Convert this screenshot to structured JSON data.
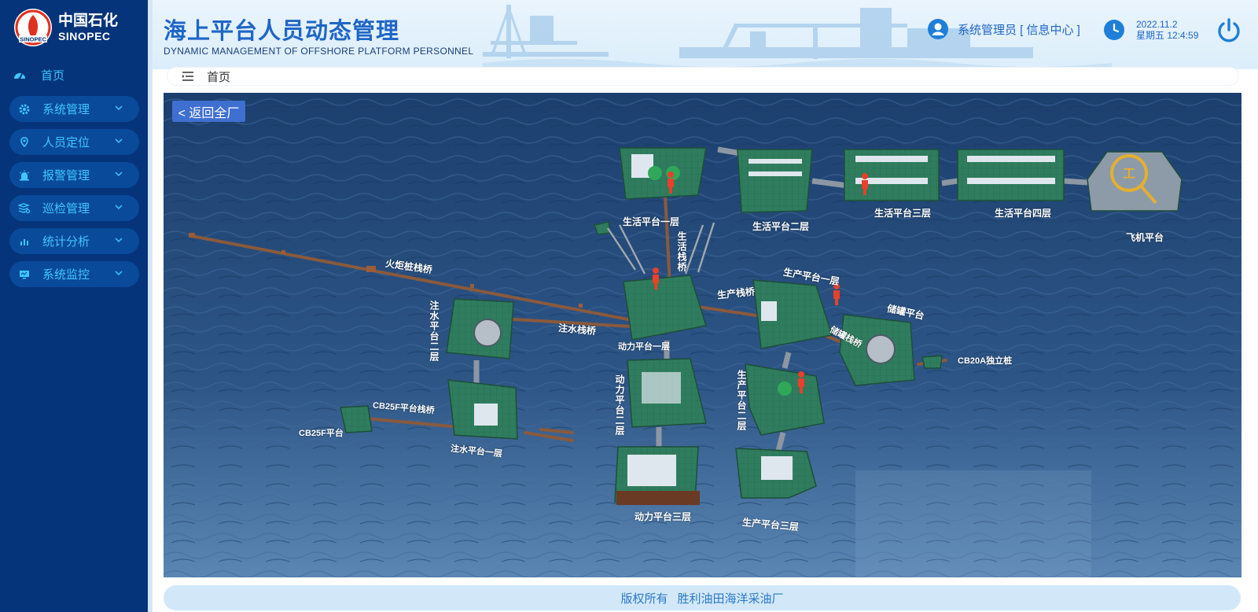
{
  "brand": {
    "logo_cn": "中国石化",
    "logo_en": "SINOPEC",
    "logo_mark_text": "SINOPEC"
  },
  "header": {
    "title": "海上平台人员动态管理",
    "subtitle": "DYNAMIC MANAGEMENT OF OFFSHORE PLATFORM PERSONNEL",
    "user": "系统管理员 [ 信息中心 ]",
    "date": "2022.11.2",
    "weekday_time": "星期五 12:4:59"
  },
  "sidebar": {
    "home": {
      "label": "首页",
      "icon": "dashboard-icon"
    },
    "items": [
      {
        "label": "系统管理",
        "icon": "gear-icon"
      },
      {
        "label": "人员定位",
        "icon": "location-pin-icon"
      },
      {
        "label": "报警管理",
        "icon": "alarm-icon"
      },
      {
        "label": "巡检管理",
        "icon": "inspection-icon"
      },
      {
        "label": "统计分析",
        "icon": "bar-chart-icon"
      },
      {
        "label": "系统监控",
        "icon": "monitor-icon"
      }
    ]
  },
  "breadcrumb": {
    "label": "首页"
  },
  "map": {
    "back_button": "< 返回全厂",
    "labels": {
      "living1": "生活平台一层",
      "living2": "生活平台二层",
      "living3": "生活平台三层",
      "living4": "生活平台四层",
      "heli": "飞机平台",
      "living_bridge": "生活栈桥",
      "flare_bridge": "火炬桩栈桥",
      "prod_bridge": "生产栈桥",
      "prod1": "生产平台一层",
      "storage": "储罐平台",
      "storage_bridge": "储罐栈桥",
      "cb20a": "CB20A独立桩",
      "inject2": "注水平台二层",
      "inject_bridge": "注水栈桥",
      "power1": "动力平台一层",
      "power2": "动力平台二层",
      "prod2": "生产平台二层",
      "cb25f_bridge": "CB25F平台栈桥",
      "cb25f": "CB25F平台",
      "inject1": "注水平台一层",
      "power3": "动力平台三层",
      "prod3": "生产平台三层"
    },
    "colors": {
      "sea": "#2a4f7e",
      "deck": "#2f7d5e",
      "person": "#e8402a",
      "bridge": "#8a5a3c"
    }
  },
  "footer": {
    "copyright": "版权所有",
    "company": "胜利油田海洋采油厂"
  }
}
